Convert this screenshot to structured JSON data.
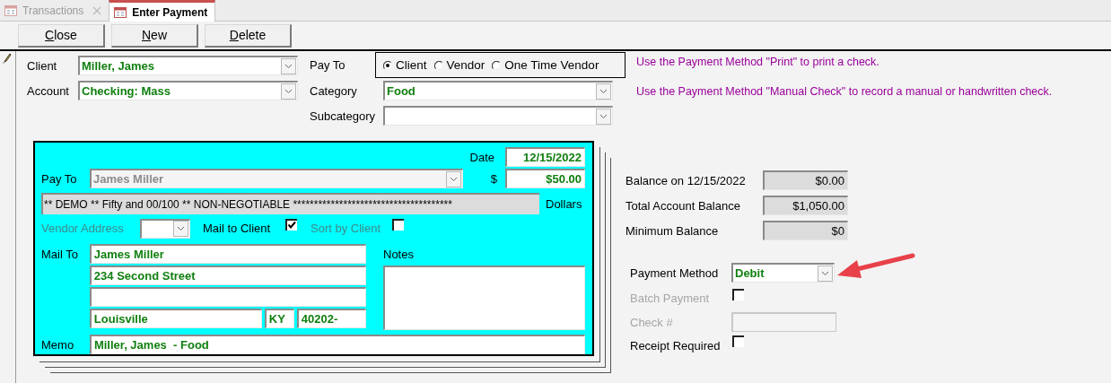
{
  "tabs": [
    {
      "label": "Transactions",
      "selected": false,
      "closable": true
    },
    {
      "label": "Enter Payment",
      "selected": true,
      "closable": false
    }
  ],
  "buttons": [
    {
      "label": "Close",
      "underline_first": true
    },
    {
      "label": "New",
      "underline_first": true
    },
    {
      "label": "Delete",
      "underline_first": true
    }
  ],
  "client": {
    "label": "Client",
    "value": "Miller, James"
  },
  "account": {
    "label": "Account",
    "value": "Checking: Mass"
  },
  "pay_to_type": {
    "label": "Pay To",
    "options": [
      {
        "label": "Client",
        "selected": true
      },
      {
        "label": "Vendor",
        "selected": false
      },
      {
        "label": "One Time Vendor",
        "selected": false
      }
    ]
  },
  "category": {
    "label": "Category",
    "value": "Food"
  },
  "subcategory": {
    "label": "Subcategory"
  },
  "hints": [
    "Use the Payment Method \"Print\" to print a check.",
    "Use the Payment Method \"Manual Check\" to record a manual or handwritten check."
  ],
  "check": {
    "date": {
      "label": "Date",
      "value": "12/15/2022"
    },
    "pay_to": {
      "label": "Pay To",
      "value": "James Miller",
      "disabled": true
    },
    "amount": {
      "label": "$",
      "value": "$50.00"
    },
    "amount_words": {
      "value": "** DEMO ** Fifty and 00/100 ** NON-NEGOTIABLE **************************************",
      "suffix": "Dollars"
    },
    "vendor_address": {
      "label": "Vendor Address",
      "disabled": true
    },
    "mail_to_client": {
      "label": "Mail to Client",
      "checked": true
    },
    "sort_by_client": {
      "label": "Sort by Client",
      "checked": false,
      "disabled": true
    },
    "mail_to": {
      "label": "Mail To",
      "name": "James Miller",
      "address1": "234 Second Street",
      "city": "Louisville",
      "state": "KY",
      "zip": "40202-"
    },
    "notes": {
      "label": "Notes"
    },
    "memo": {
      "label": "Memo",
      "value": "Miller, James  - Food"
    }
  },
  "balances": [
    {
      "label": "Balance on 12/15/2022",
      "value": "$0.00"
    },
    {
      "label": "Total Account Balance",
      "value": "$1,050.00"
    },
    {
      "label": "Minimum Balance",
      "value": "$0"
    }
  ],
  "payment_method": {
    "label": "Payment Method",
    "value": "Debit"
  },
  "batch_payment": {
    "label": "Batch Payment",
    "checked": false,
    "disabled": true
  },
  "check_number": {
    "label": "Check #",
    "disabled": true
  },
  "receipt_required": {
    "label": "Receipt Required",
    "checked": false
  }
}
